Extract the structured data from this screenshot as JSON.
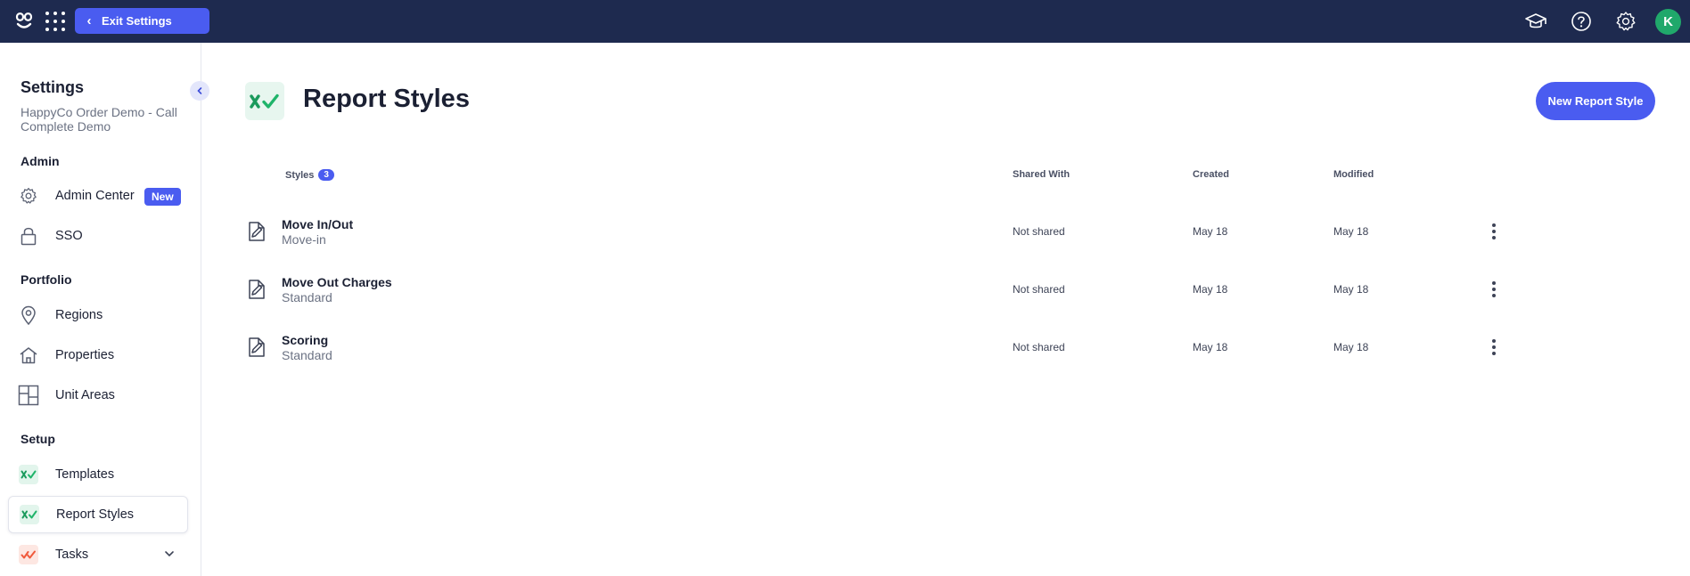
{
  "topbar": {
    "logo_icon": "happyco-logo-icon",
    "apps_icon": "app-grid-icon",
    "exit_label": "Exit Settings",
    "right_icons": [
      "graduation-cap-icon",
      "help-circle-icon",
      "gear-icon"
    ],
    "avatar_initial": "K"
  },
  "sidebar": {
    "title": "Settings",
    "org": "HappyCo Order Demo - Call Complete Demo",
    "sections": {
      "admin": "Admin",
      "portfolio": "Portfolio",
      "setup": "Setup"
    },
    "items": {
      "admin_center": "Admin Center",
      "admin_center_badge": "New",
      "sso": "SSO",
      "regions": "Regions",
      "properties": "Properties",
      "unit_areas": "Unit Areas",
      "templates": "Templates",
      "report_styles": "Report Styles",
      "tasks": "Tasks"
    }
  },
  "main": {
    "title": "Report Styles",
    "new_button": "New Report Style",
    "columns": {
      "styles": "Styles",
      "styles_count": "3",
      "shared_with": "Shared With",
      "created": "Created",
      "modified": "Modified"
    },
    "rows": [
      {
        "name": "Move In/Out",
        "type": "Move-in",
        "shared": "Not shared",
        "created": "May 18",
        "modified": "May 18"
      },
      {
        "name": "Move Out Charges",
        "type": "Standard",
        "shared": "Not shared",
        "created": "May 18",
        "modified": "May 18"
      },
      {
        "name": "Scoring",
        "type": "Standard",
        "shared": "Not shared",
        "created": "May 18",
        "modified": "May 18"
      }
    ]
  },
  "colors": {
    "topbar": "#1e2a4f",
    "accent": "#4a5cf0",
    "avatar": "#20a86b",
    "brand_green": "#1fb46a"
  }
}
